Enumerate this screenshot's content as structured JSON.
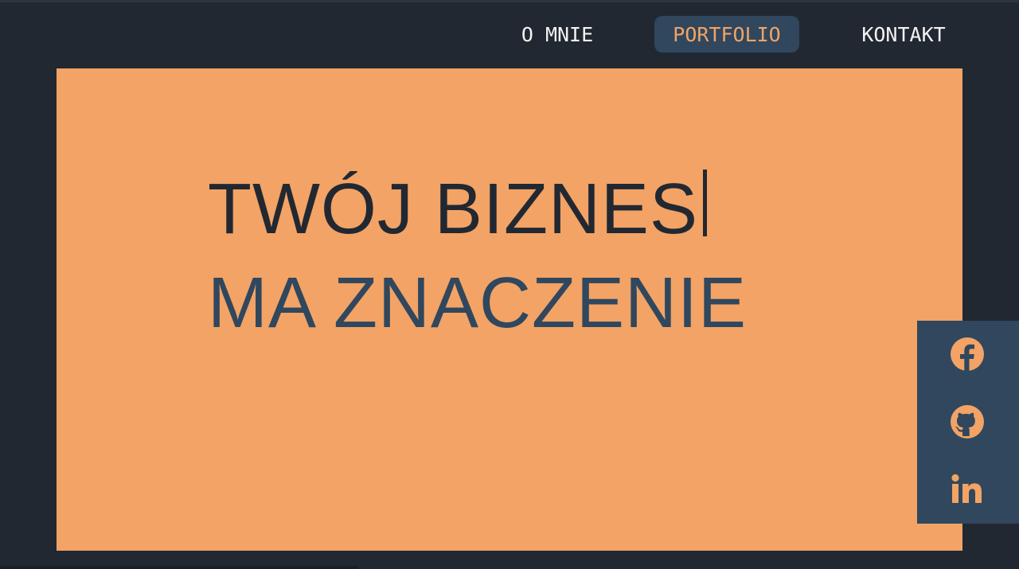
{
  "nav": {
    "items": [
      {
        "label": "O MNIE",
        "active": false
      },
      {
        "label": "PORTFOLIO",
        "active": true
      },
      {
        "label": "KONTAKT",
        "active": false
      }
    ]
  },
  "hero": {
    "line1": "TWÓJ BIZNES",
    "line2": "MA ZNACZENIE"
  },
  "social": {
    "links": [
      {
        "icon": "facebook-icon"
      },
      {
        "icon": "github-icon"
      },
      {
        "icon": "linkedin-icon"
      }
    ]
  },
  "colors": {
    "background": "#222831",
    "accent": "#f2a365",
    "secondary": "#30475e",
    "text_light": "#f2f2f2"
  }
}
